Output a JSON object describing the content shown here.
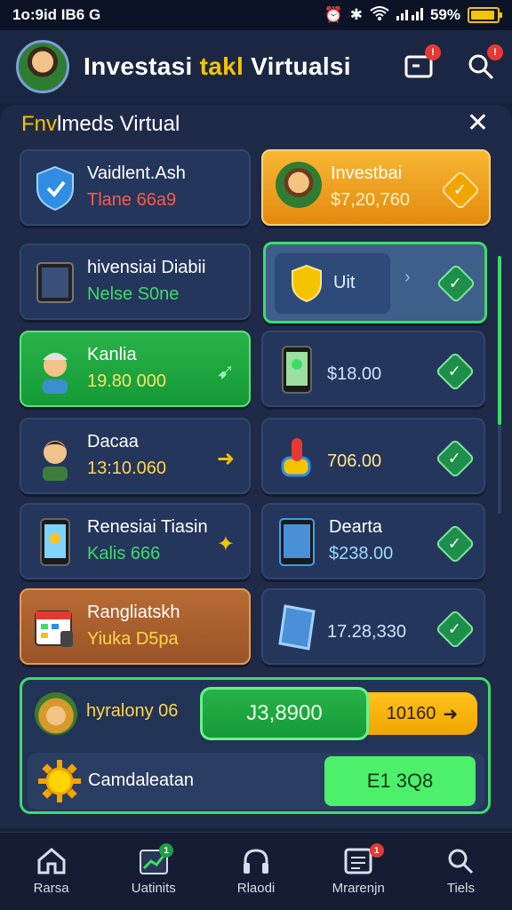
{
  "status_bar": {
    "time": "1o:9id IB6 G",
    "battery": "59%"
  },
  "header": {
    "title_part1": "Investasi ",
    "title_highlight": "takl",
    "title_part2": " Virtualsi",
    "notif_badge": "!",
    "search_badge": "!"
  },
  "panel": {
    "title_first": "Fnv",
    "title_rest": "lmeds Virtual",
    "close": "✕"
  },
  "left_cards": [
    {
      "title": "Vaidlent.Ash",
      "amount": "Tlane 66a9",
      "amount_color": "#ff5a4a",
      "icon": "shield-icon"
    },
    {
      "title": "hivensiai Diabii",
      "amount": "Nelse S0ne",
      "amount_color": "#3ddc6a",
      "icon": "tablet-icon"
    },
    {
      "title": "Kanlia",
      "amount": "19.80 000",
      "amount_color": "#ffd54a",
      "icon": "worker-avatar-icon"
    },
    {
      "title": "Dacaa",
      "amount": "13:10.060",
      "amount_color": "#ffd54a",
      "icon": "man-avatar-icon"
    },
    {
      "title": "Renesiai Tiasin",
      "amount": "Kalis 666",
      "amount_color": "#3ddc6a",
      "icon": "phone-icon"
    },
    {
      "title": "Rangliatskh",
      "amount": "Yiuka D5pa",
      "amount_color": "#ffd54a",
      "icon": "calendar-icon"
    }
  ],
  "right_cards": [
    {
      "title": "Investbai",
      "amount": "$7,20,760"
    },
    {
      "label": "Uit"
    },
    {
      "amount": "$18.00"
    },
    {
      "amount": "706.00"
    },
    {
      "title": "Dearta",
      "amount": "$238.00"
    },
    {
      "amount": "17.28,330"
    }
  ],
  "summary": {
    "label": "hyralony 06",
    "green_value": "J3,8900",
    "yellow_value": "10160",
    "row2_label": "Camdaleatan",
    "row2_button": "E1 3Q8"
  },
  "nav": [
    {
      "label": "Rarsa",
      "icon": "home-icon"
    },
    {
      "label": "Uatinits",
      "icon": "chart-icon",
      "badge": "1"
    },
    {
      "label": "Rlaodi",
      "icon": "headset-icon"
    },
    {
      "label": "Mrarenjn",
      "icon": "document-icon",
      "badge": "1"
    },
    {
      "label": "Tiels",
      "icon": "search-icon"
    }
  ],
  "colors": {
    "accent_green": "#3ddc6a",
    "accent_yellow": "#f5c400",
    "panel": "#1e2a47"
  }
}
